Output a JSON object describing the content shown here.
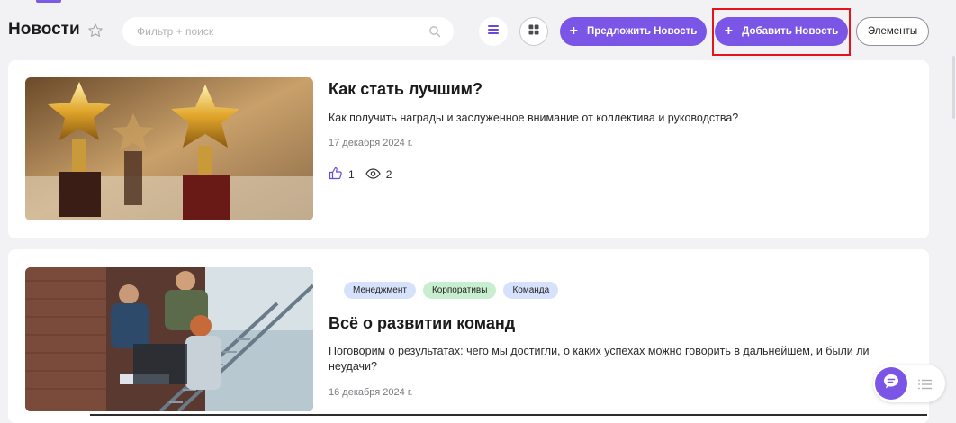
{
  "header": {
    "title": "Новости",
    "search_placeholder": "Фильтр + поиск",
    "suggest_label": "Предложить Новость",
    "add_label": "Добавить Новость",
    "elements_label": "Элементы"
  },
  "news": [
    {
      "title": "Как стать лучшим?",
      "description": "Как получить награды и заслуженное внимание от коллектива и руководства?",
      "date": "17 декабря 2024 г.",
      "likes": "1",
      "views": "2"
    },
    {
      "tags": [
        "Менеджмент",
        "Корпоративы",
        "Команда"
      ],
      "title": "Всё о развитии команд",
      "description": "Поговорим о результатах: чего мы достигли, о каких успехах можно говорить в дальнейшем, и были ли неудачи?",
      "date": "16 декабря 2024 г."
    }
  ],
  "colors": {
    "accent": "#7a55e6",
    "highlight": "#e8121c",
    "tag_blue": "#d6e2fb",
    "tag_green": "#c7efcf"
  },
  "icons": [
    "star-icon",
    "search-icon",
    "list-view-icon",
    "grid-view-icon",
    "plus-icon",
    "like-icon",
    "eye-icon",
    "chat-icon",
    "menu-icon"
  ]
}
